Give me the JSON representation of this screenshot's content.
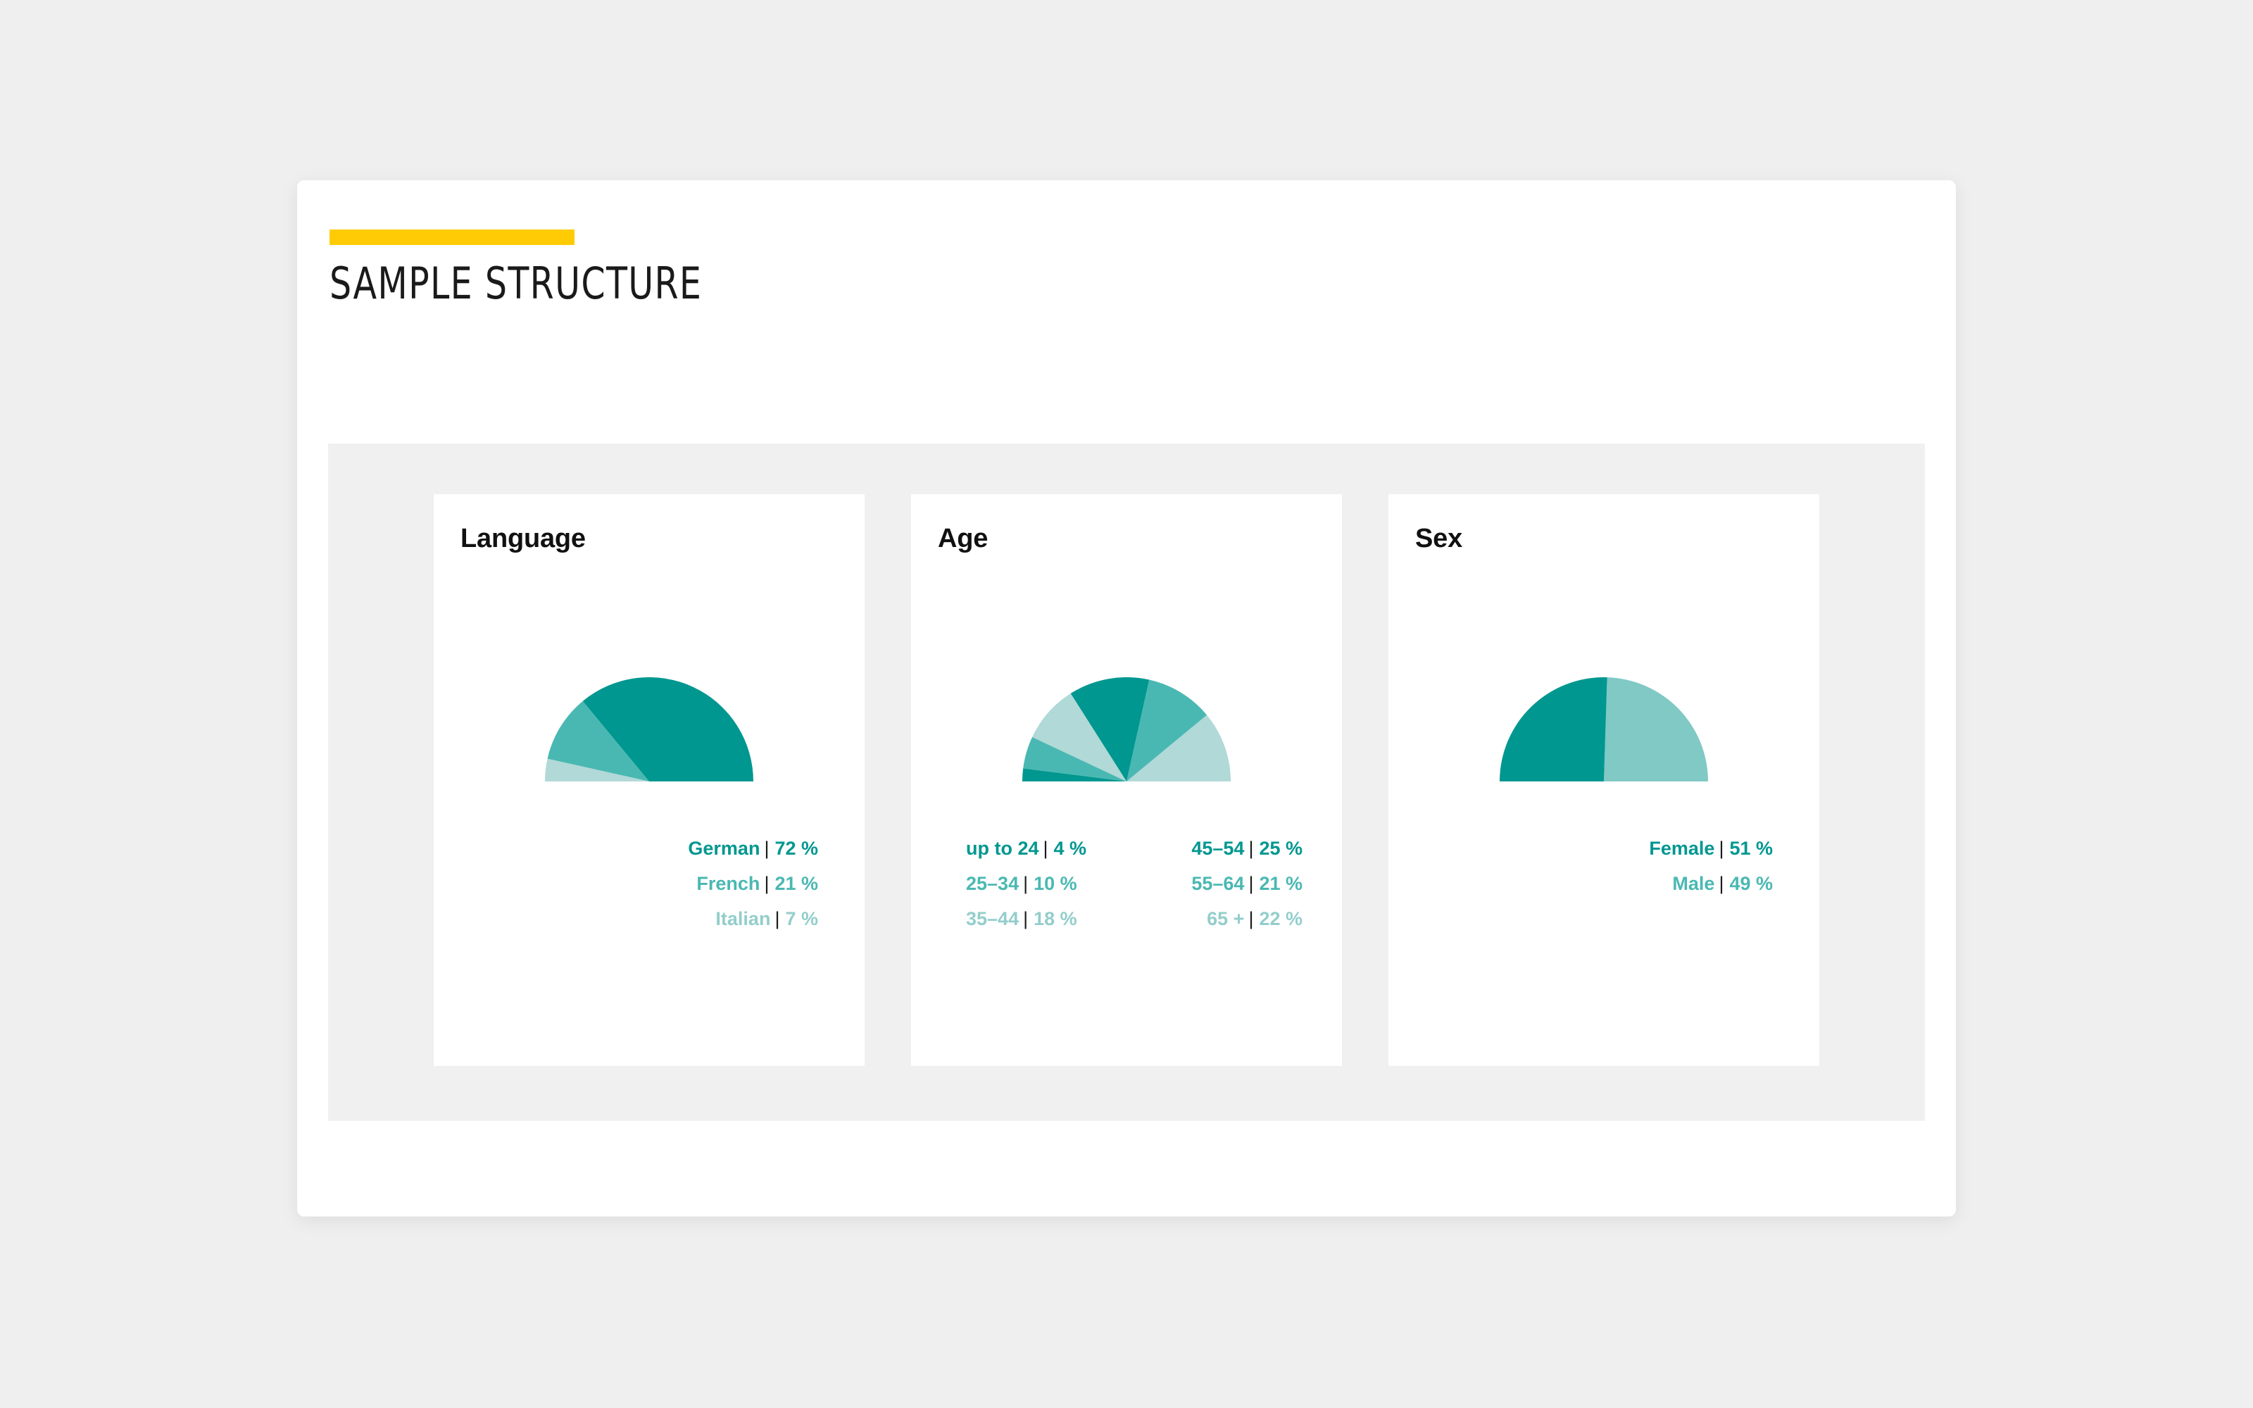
{
  "header": {
    "title": "SAMPLE STRUCTURE",
    "accent_color": "#ffcb05"
  },
  "palette": {
    "teal_dark": "#009790",
    "teal_mid": "#4ab8b2",
    "teal_light": "#b0d9d7",
    "separator": "#1a1a1a",
    "page_background": "#efefef",
    "panel_background": "#f0f0f0",
    "card_background": "#ffffff"
  },
  "cards": [
    {
      "title": "Language",
      "legend_layout": "single",
      "legend": [
        {
          "label": "German",
          "sep": "|",
          "value": "72 %",
          "color": "#009790"
        },
        {
          "label": "French",
          "sep": "|",
          "value": "21 %",
          "color": "#4ab8b2"
        },
        {
          "label": "Italian",
          "sep": "|",
          "value": "7 %",
          "color": "#93cecb"
        }
      ]
    },
    {
      "title": "Age",
      "legend_layout": "two-column",
      "legend_left": [
        {
          "label": "up to 24",
          "sep": "|",
          "value": "4 %",
          "color": "#009790"
        },
        {
          "label": "25–34",
          "sep": "|",
          "value": "10 %",
          "color": "#4ab8b2"
        },
        {
          "label": "35–44",
          "sep": "|",
          "value": "18 %",
          "color": "#93cecb"
        }
      ],
      "legend_right": [
        {
          "label": "45–54",
          "sep": "|",
          "value": "25 %",
          "color": "#009790"
        },
        {
          "label": "55–64",
          "sep": "|",
          "value": "21 %",
          "color": "#4ab8b2"
        },
        {
          "label": "65 +",
          "sep": "|",
          "value": "22 %",
          "color": "#93cecb"
        }
      ]
    },
    {
      "title": "Sex",
      "legend_layout": "single",
      "legend": [
        {
          "label": "Female",
          "sep": "|",
          "value": "51 %",
          "color": "#009790"
        },
        {
          "label": "Male",
          "sep": "|",
          "value": "49 %",
          "color": "#4ab8b2"
        }
      ]
    }
  ],
  "chart_data": [
    {
      "type": "pie",
      "variant": "half-donut-semicircle",
      "title": "Language",
      "total": 100,
      "unit": "%",
      "direction": "counterclockwise-from-right",
      "slices": [
        {
          "label": "German",
          "value": 72,
          "color": "#009790"
        },
        {
          "label": "French",
          "value": 21,
          "color": "#4ab8b2"
        },
        {
          "label": "Italian",
          "value": 7,
          "color": "#b0d9d7"
        }
      ]
    },
    {
      "type": "pie",
      "variant": "half-donut-semicircle",
      "title": "Age",
      "total": 100,
      "unit": "%",
      "direction": "counterclockwise-from-right",
      "slices": [
        {
          "label": "65 +",
          "value": 22,
          "color": "#b0d9d7"
        },
        {
          "label": "55–64",
          "value": 21,
          "color": "#4ab8b2"
        },
        {
          "label": "45–54",
          "value": 25,
          "color": "#009790"
        },
        {
          "label": "35–44",
          "value": 18,
          "color": "#b0d9d7"
        },
        {
          "label": "25–34",
          "value": 10,
          "color": "#4ab8b2"
        },
        {
          "label": "up to 24",
          "value": 4,
          "color": "#009790"
        }
      ]
    },
    {
      "type": "pie",
      "variant": "half-donut-semicircle",
      "title": "Sex",
      "total": 100,
      "unit": "%",
      "direction": "counterclockwise-from-right",
      "slices": [
        {
          "label": "Male",
          "value": 49,
          "color": "#80c9c5"
        },
        {
          "label": "Female",
          "value": 51,
          "color": "#009790"
        }
      ]
    }
  ]
}
